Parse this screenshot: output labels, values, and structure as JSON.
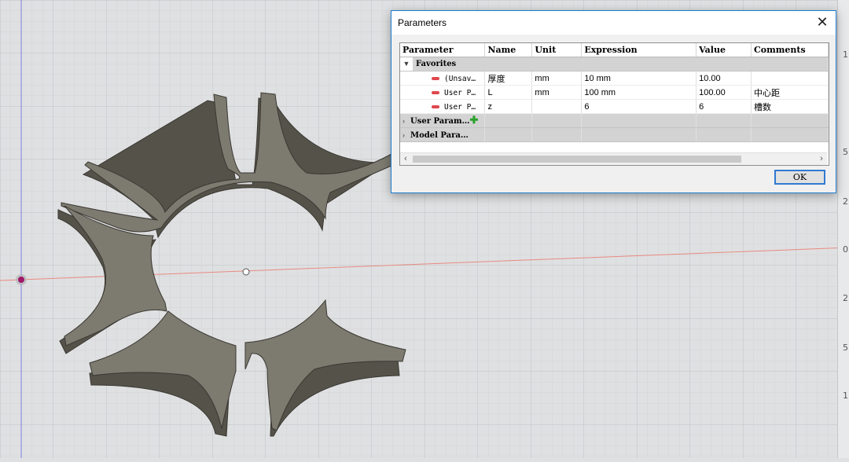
{
  "dialog": {
    "title": "Parameters",
    "close_label": "✕",
    "ok_label": "OK",
    "columns": [
      "Parameter",
      "Name",
      "Unit",
      "Expression",
      "Value",
      "Comments"
    ],
    "favorites_label": "Favorites",
    "rows": [
      {
        "parameter": "(Unsav…",
        "name": "厚度",
        "unit": "mm",
        "expression": "10 mm",
        "value": "10.00",
        "comments": ""
      },
      {
        "parameter": "User P…",
        "name": "L",
        "unit": "mm",
        "expression": "100 mm",
        "value": "100.00",
        "comments": "中心距"
      },
      {
        "parameter": "User P…",
        "name": "z",
        "unit": "",
        "expression": "6",
        "value": "6",
        "comments": "槽数"
      }
    ],
    "user_params_label": "User Param…",
    "model_params_label": "Model Para…",
    "scroll_left": "‹",
    "scroll_right": "›"
  },
  "ruler": {
    "labels": [
      "1",
      "5",
      "2",
      "0",
      "2",
      "5",
      "1"
    ]
  },
  "colors": {
    "viewport_bg": "#dfe0e2",
    "part_face": "#7d7a70",
    "part_side": "#545249",
    "x_axis": "#e88a80",
    "y_axis": "#7f7fe0",
    "dialog_border": "#1b7bd0"
  }
}
